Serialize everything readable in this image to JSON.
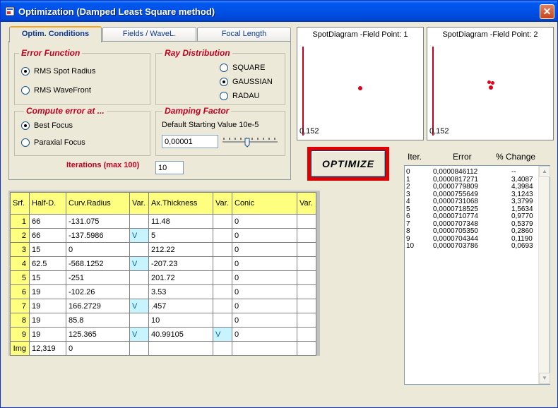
{
  "window": {
    "title": "Optimization  (Damped Least Square method)",
    "close_label": "✕"
  },
  "tabs": [
    {
      "label": "Optim. Conditions"
    },
    {
      "label": "Fields / WaveL."
    },
    {
      "label": "Focal Length"
    }
  ],
  "error_function": {
    "title": "Error Function",
    "options": [
      "RMS Spot Radius",
      "RMS WaveFront"
    ]
  },
  "ray_distribution": {
    "title": "Ray Distribution",
    "options": [
      "SQUARE",
      "GAUSSIAN",
      "RADAU"
    ]
  },
  "compute_error": {
    "title": "Compute error  at ...",
    "options": [
      "Best  Focus",
      "Paraxial Focus"
    ]
  },
  "damping": {
    "title": "Damping Factor",
    "caption": "Default Starting Value 10e-5",
    "value": "0,00001"
  },
  "iterations": {
    "label": "Iterations (max 100)",
    "value": "10"
  },
  "spot1": {
    "title": "SpotDiagram -Field Point: 1",
    "scale": "0,152"
  },
  "spot2": {
    "title": "SpotDiagram -Field Point: 2",
    "scale": "0,152"
  },
  "optimize_label": "OPTIMIZE",
  "table": {
    "headers": [
      "Srf.",
      "Half-D.",
      "Curv.Radius",
      "Var.",
      "Ax.Thickness",
      "Var.",
      "Conic",
      "Var."
    ],
    "rows": [
      [
        "1",
        "66",
        "-131.075",
        "",
        "11.48",
        "",
        "0",
        ""
      ],
      [
        "2",
        "66",
        "-137.5986",
        "V",
        "5",
        "",
        "0",
        ""
      ],
      [
        "3",
        "15",
        "0",
        "",
        "212.22",
        "",
        "0",
        ""
      ],
      [
        "4",
        "62.5",
        "-568.1252",
        "V",
        "-207.23",
        "",
        "0",
        ""
      ],
      [
        "5",
        "15",
        "-251",
        "",
        "201.72",
        "",
        "0",
        ""
      ],
      [
        "6",
        "19",
        "-102.26",
        "",
        "3.53",
        "",
        "0",
        ""
      ],
      [
        "7",
        "19",
        "166.2729",
        "V",
        ".457",
        "",
        "0",
        ""
      ],
      [
        "8",
        "19",
        "85.8",
        "",
        "10",
        "",
        "0",
        ""
      ],
      [
        "9",
        "19",
        "125.365",
        "V",
        "40.99105",
        "V",
        "0",
        ""
      ],
      [
        "Img",
        "12,319",
        "0",
        "",
        "",
        "",
        "",
        ""
      ]
    ]
  },
  "iter_list": {
    "headers": [
      "Iter.",
      "Error",
      "% Change"
    ],
    "rows": [
      [
        "0",
        "0,0000846112",
        "--"
      ],
      [
        "1",
        "0,0000817271",
        "3,4087"
      ],
      [
        "2",
        "0,0000779809",
        "4,3984"
      ],
      [
        "3",
        "0,0000755649",
        "3,1243"
      ],
      [
        "4",
        "0,0000731068",
        "3,3799"
      ],
      [
        "5",
        "0,0000718525",
        "1,5634"
      ],
      [
        "6",
        "0,0000710774",
        "0,9770"
      ],
      [
        "7",
        "0,0000707348",
        "0,5379"
      ],
      [
        "8",
        "0,0000705350",
        "0,2860"
      ],
      [
        "9",
        "0,0000704344",
        "0,1190"
      ],
      [
        "10",
        "0,0000703786",
        "0,0693"
      ]
    ]
  },
  "colors": {
    "accent_red": "#c4001e",
    "header_yellow": "#ffff7f",
    "var_cyan": "#c8f4ff",
    "title_blue": "#0050e6"
  }
}
